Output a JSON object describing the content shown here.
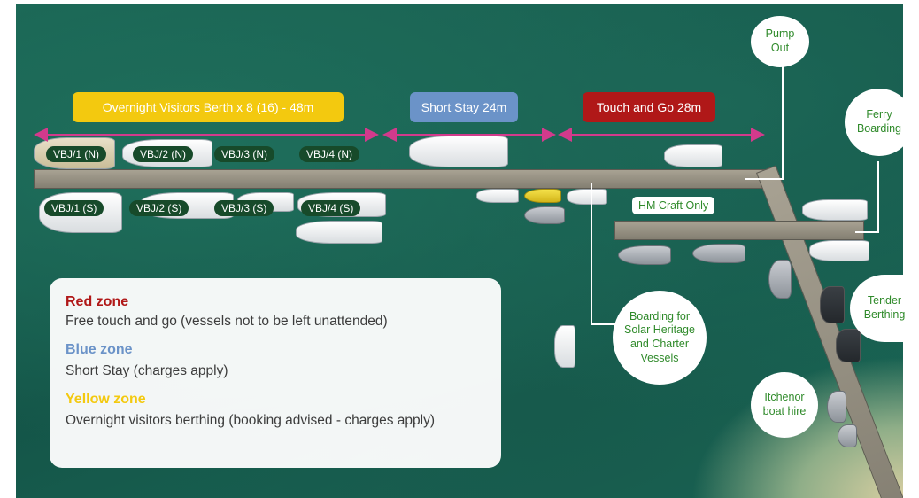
{
  "zones": {
    "overnight": {
      "label": "Overnight Visitors Berth x 8 (16) - 48m",
      "color": "#f3c90f"
    },
    "short_stay": {
      "label": "Short Stay 24m",
      "color": "#6b93c8"
    },
    "touch_go": {
      "label": "Touch and Go 28m",
      "color": "#b01818"
    }
  },
  "berths": {
    "north": [
      "VBJ/1 (N)",
      "VBJ/2 (N)",
      "VBJ/3 (N)",
      "VBJ/4 (N)"
    ],
    "south": [
      "VBJ/1 (S)",
      "VBJ/2 (S)",
      "VBJ/3 (S)",
      "VBJ/4 (S)"
    ]
  },
  "callouts": {
    "pump_out": [
      "Pump",
      "Out"
    ],
    "ferry": [
      "Ferry",
      "Boarding"
    ],
    "tender": [
      "Tender",
      "Berthing"
    ],
    "solar": [
      "Boarding for",
      "Solar Heritage",
      "and Charter",
      "Vessels"
    ],
    "itchenor": [
      "Itchenor",
      "boat hire"
    ],
    "hm_craft": "HM Craft Only"
  },
  "legend": {
    "red": {
      "title": "Red zone",
      "desc": "Free touch and go (vessels not to be left unattended)",
      "color": "#b01818"
    },
    "blue": {
      "title": "Blue zone",
      "desc": "Short Stay (charges apply)",
      "color": "#6b93c8"
    },
    "yellow": {
      "title": "Yellow zone",
      "desc": "Overnight visitors berthing (booking advised - charges apply)",
      "color": "#f3c90f"
    }
  },
  "colors": {
    "arrow": "#d23a8c",
    "callout_line": "#ffffff",
    "label_text": "#2f8a2a"
  }
}
